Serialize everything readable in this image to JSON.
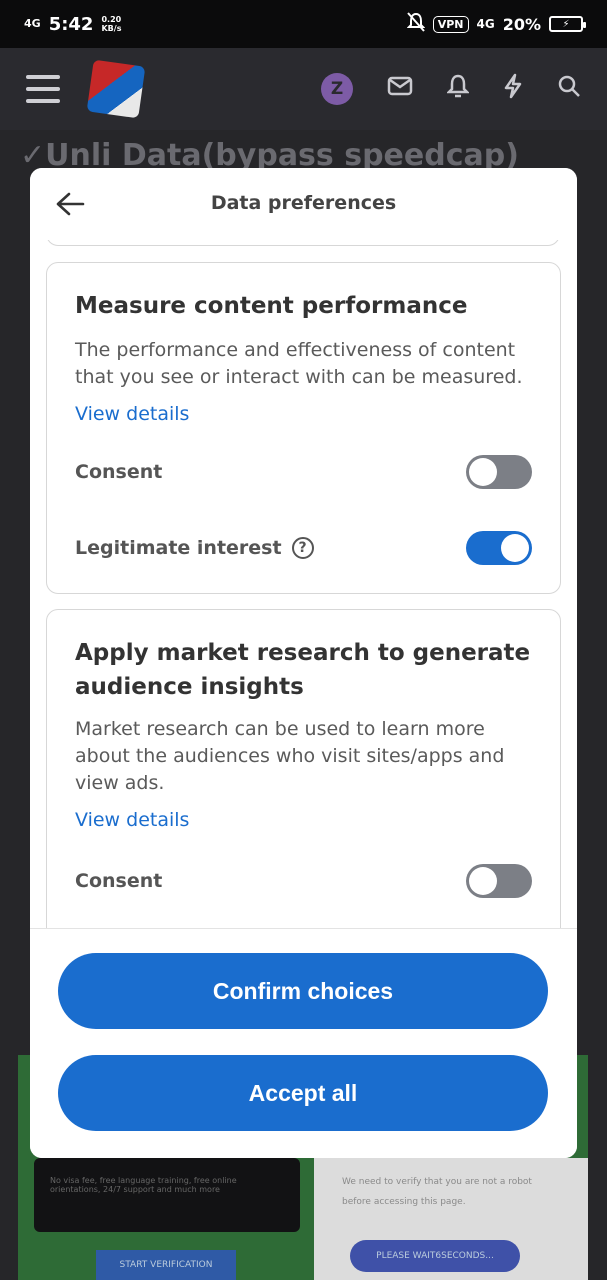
{
  "status_bar": {
    "network": "4G",
    "time": "5:42",
    "speed_value": "0.20",
    "speed_unit": "KB/s",
    "vpn": "VPN",
    "network2": "4G",
    "battery": "20%"
  },
  "site_header": {
    "avatar_letter": "Z",
    "icons": [
      "menu-icon",
      "mail-icon",
      "bell-icon",
      "bolt-icon",
      "search-icon"
    ]
  },
  "background": {
    "text": "✓Unli Data(bypass speedcap)",
    "card1_text": "No visa fee, free language training, free online orientations, 24/7 support and much more",
    "card1_button": "START VERIFICATION",
    "card2_text": "We need to verify that you are not a robot before accessing this page.",
    "card2_button": "PLEASE WAIT6SECONDS..."
  },
  "modal": {
    "title": "Data preferences",
    "cards": [
      {
        "title": "Measure content performance",
        "description": "The performance and effectiveness of content that you see or interact with can be measured.",
        "view_details": "View details",
        "consent_label": "Consent",
        "consent_on": false,
        "legit_label": "Legitimate interest",
        "legit_on": true
      },
      {
        "title": "Apply market research to generate audience insights",
        "description": "Market research can be used to learn more about the audiences who visit sites/apps and view ads.",
        "view_details": "View details",
        "consent_label": "Consent",
        "consent_on": false
      }
    ],
    "confirm_label": "Confirm choices",
    "accept_label": "Accept all"
  },
  "colors": {
    "primary": "#1a6dce",
    "toggle_off": "#7c7f86"
  }
}
